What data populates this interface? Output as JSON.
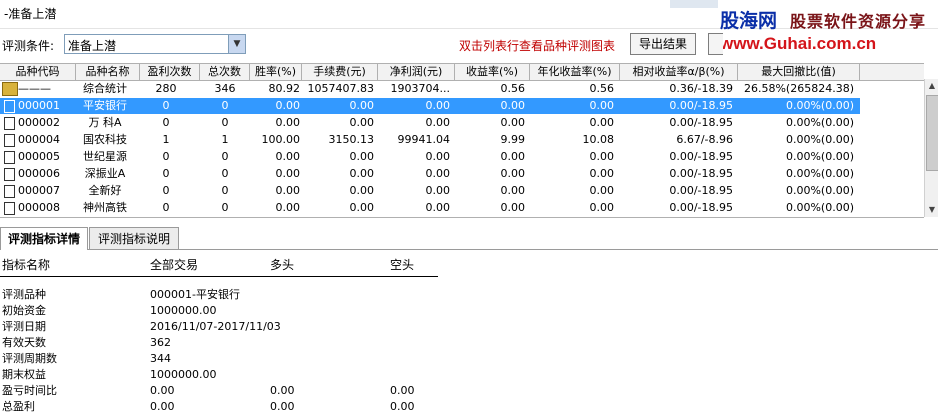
{
  "window": {
    "title": "-准备上潜"
  },
  "brand": {
    "name": "股海网",
    "tagline": "股票软件资源分享",
    "url": "www.Guhai.com.cn"
  },
  "toolbar": {
    "condition_label": "评测条件:",
    "condition_value": "准备上潜",
    "hint": "双击列表行查看品种评测图表",
    "export_label": "导出结果"
  },
  "grid": {
    "headers": [
      "品种代码",
      "品种名称",
      "盈利次数",
      "总次数",
      "胜率(%)",
      "手续费(元)",
      "净利润(元)",
      "收益率(%)",
      "年化收益率(%)",
      "相对收益率α/β(%)",
      "最大回撤比(值)"
    ],
    "rows": [
      {
        "code": "———",
        "name": "综合统计",
        "wins": "280",
        "total": "346",
        "winrate": "80.92",
        "fee": "1057407.83",
        "profit": "1903704...",
        "ret": "0.56",
        "annual": "0.56",
        "relative": "0.36/-18.39",
        "drawdown": "26.58%(265824.38)"
      },
      {
        "code": "000001",
        "name": "平安银行",
        "wins": "0",
        "total": "0",
        "winrate": "0.00",
        "fee": "0.00",
        "profit": "0.00",
        "ret": "0.00",
        "annual": "0.00",
        "relative": "0.00/-18.95",
        "drawdown": "0.00%(0.00)"
      },
      {
        "code": "000002",
        "name": "万 科A",
        "wins": "0",
        "total": "0",
        "winrate": "0.00",
        "fee": "0.00",
        "profit": "0.00",
        "ret": "0.00",
        "annual": "0.00",
        "relative": "0.00/-18.95",
        "drawdown": "0.00%(0.00)"
      },
      {
        "code": "000004",
        "name": "国农科技",
        "wins": "1",
        "total": "1",
        "winrate": "100.00",
        "fee": "3150.13",
        "profit": "99941.04",
        "ret": "9.99",
        "annual": "10.08",
        "relative": "6.67/-8.96",
        "drawdown": "0.00%(0.00)"
      },
      {
        "code": "000005",
        "name": "世纪星源",
        "wins": "0",
        "total": "0",
        "winrate": "0.00",
        "fee": "0.00",
        "profit": "0.00",
        "ret": "0.00",
        "annual": "0.00",
        "relative": "0.00/-18.95",
        "drawdown": "0.00%(0.00)"
      },
      {
        "code": "000006",
        "name": "深振业A",
        "wins": "0",
        "total": "0",
        "winrate": "0.00",
        "fee": "0.00",
        "profit": "0.00",
        "ret": "0.00",
        "annual": "0.00",
        "relative": "0.00/-18.95",
        "drawdown": "0.00%(0.00)"
      },
      {
        "code": "000007",
        "name": "全新好",
        "wins": "0",
        "total": "0",
        "winrate": "0.00",
        "fee": "0.00",
        "profit": "0.00",
        "ret": "0.00",
        "annual": "0.00",
        "relative": "0.00/-18.95",
        "drawdown": "0.00%(0.00)"
      },
      {
        "code": "000008",
        "name": "神州高铁",
        "wins": "0",
        "total": "0",
        "winrate": "0.00",
        "fee": "0.00",
        "profit": "0.00",
        "ret": "0.00",
        "annual": "0.00",
        "relative": "0.00/-18.95",
        "drawdown": "0.00%(0.00)"
      }
    ]
  },
  "tabs": [
    "评测指标详情",
    "评测指标说明"
  ],
  "detail": {
    "headers": [
      "指标名称",
      "全部交易",
      "多头",
      "空头"
    ],
    "rows": [
      {
        "label": "评测品种",
        "all": "000001-平安银行",
        "long": "",
        "short": ""
      },
      {
        "label": "初始资金",
        "all": "1000000.00",
        "long": "",
        "short": ""
      },
      {
        "label": "评测日期",
        "all": "2016/11/07-2017/11/03",
        "long": "",
        "short": ""
      },
      {
        "label": "有效天数",
        "all": "362",
        "long": "",
        "short": ""
      },
      {
        "label": "评测周期数",
        "all": "344",
        "long": "",
        "short": ""
      },
      {
        "label": "期末权益",
        "all": "1000000.00",
        "long": "",
        "short": ""
      },
      {
        "label": "盈亏时间比",
        "all": "0.00",
        "long": "0.00",
        "short": "0.00"
      },
      {
        "label": "总盈利",
        "all": "0.00",
        "long": "0.00",
        "short": "0.00"
      }
    ]
  }
}
